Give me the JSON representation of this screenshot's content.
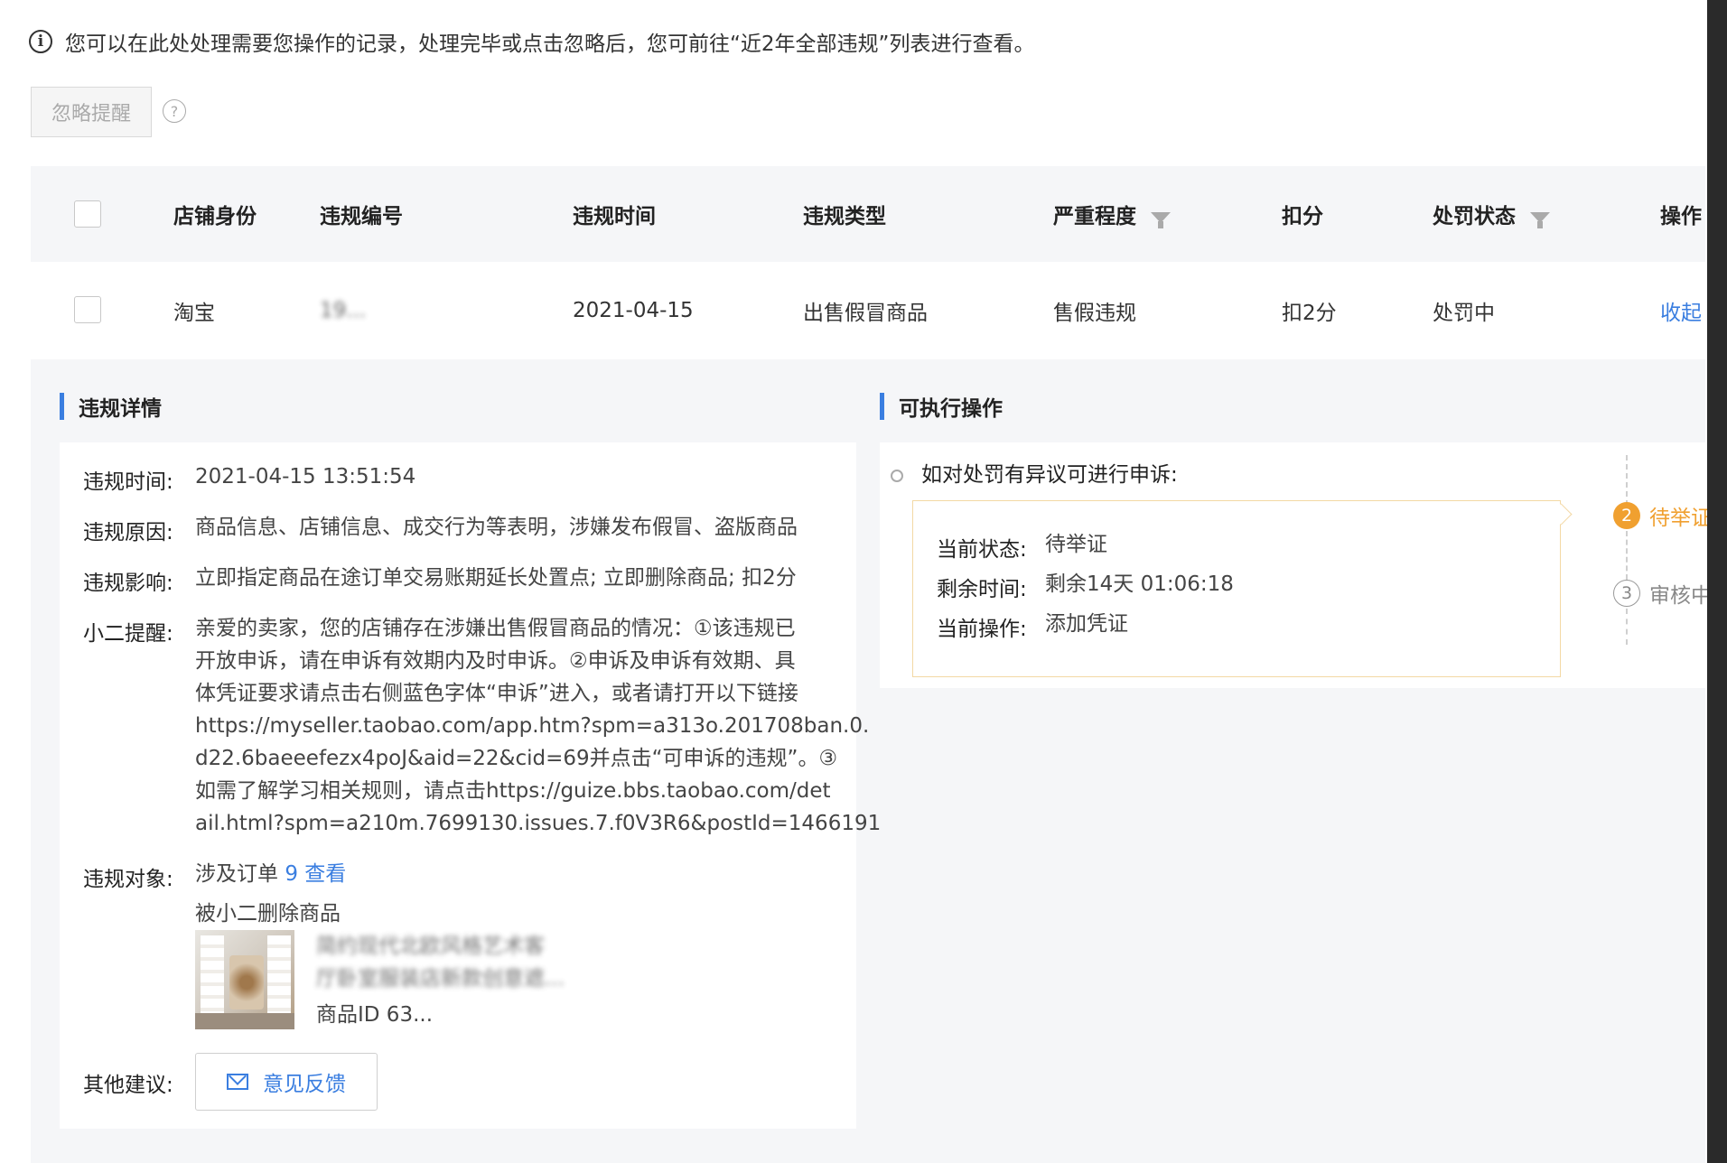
{
  "notice": {
    "text": "您可以在此处处理需要您操作的记录，处理完毕或点击忽略后，您可前往“近2年全部违规”列表进行查看。"
  },
  "toolbar": {
    "ignore_label": "忽略提醒",
    "help_glyph": "?"
  },
  "table": {
    "headers": {
      "shop": "店铺身份",
      "id": "违规编号",
      "time": "违规时间",
      "type": "违规类型",
      "severity": "严重程度",
      "points": "扣分",
      "status": "处罚状态",
      "action": "操作"
    },
    "row": {
      "shop": "淘宝",
      "id": "19...",
      "time": "2021-04-15",
      "type": "出售假冒商品",
      "severity": "售假违规",
      "points": "扣2分",
      "status": "处罚中",
      "action": "收起"
    }
  },
  "detail": {
    "title": "违规详情",
    "time_label": "违规时间:",
    "time_value": "2021-04-15 13:51:54",
    "reason_label": "违规原因:",
    "reason_value": "商品信息、店铺信息、成交行为等表明，涉嫌发布假冒、盗版商品",
    "impact_label": "违规影响:",
    "impact_value": "立即指定商品在途订单交易账期延长处置点; 立即删除商品; 扣2分",
    "remind_label": "小二提醒:",
    "remind_lines": [
      "亲爱的卖家，您的店铺存在涉嫌出售假冒商品的情况：①该违规已",
      "开放申诉，请在申诉有效期内及时申诉。②申诉及申诉有效期、具",
      "体凭证要求请点击右侧蓝色字体“申诉”进入，或者请打开以下链接",
      "https://myseller.taobao.com/app.htm?spm=a313o.201708ban.0.",
      "d22.6baeeefezx4poJ&aid=22&cid=69并点击“可申诉的违规”。③",
      "如需了解学习相关规则，请点击https://guize.bbs.taobao.com/det",
      "ail.html?spm=a210m.7699130.issues.7.f0V3R6&postId=1466191"
    ],
    "object_label": "违规对象:",
    "object_prefix": "涉及订单",
    "object_count": "9",
    "object_view": "查看",
    "deleted_label": "被小二删除商品",
    "product_title_1": "简约现代北欧风格艺术客",
    "product_title_2": "厅卧室服装店新款创意遮...",
    "product_id": "商品ID 63...",
    "other_label": "其他建议:",
    "feedback_label": "意见反馈"
  },
  "actions": {
    "title": "可执行操作",
    "appeal_prompt": "如对处罚有异议可进行申诉:",
    "status_label": "当前状态:",
    "status_value": "待举证",
    "remain_label": "剩余时间:",
    "remain_value": "剩余14天 01:06:18",
    "op_label": "当前操作:",
    "op_value": "添加凭证",
    "steps": [
      {
        "num": "2",
        "label": "待举证"
      },
      {
        "num": "3",
        "label": "审核中"
      }
    ]
  },
  "colors": {
    "accent": "#3a7ee0",
    "step_active": "#f0a030",
    "box_border": "#f3d8a4"
  }
}
